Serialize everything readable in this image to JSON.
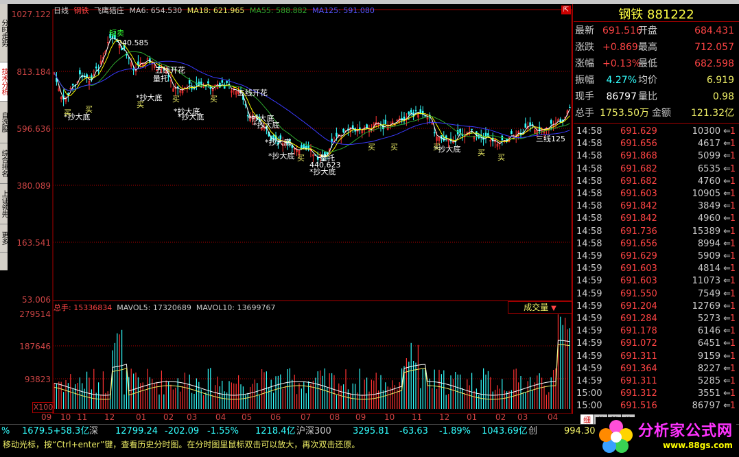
{
  "stock": {
    "name": "钢铁",
    "code": "881222"
  },
  "legend": {
    "period": "日线",
    "name": "钢铁",
    "indicator": "飞鹰猎庄",
    "ma6": "MA6: 654.530",
    "ma18": "MA18: 621.965",
    "ma55": "MA55: 588.882",
    "ma125": "MA125: 591.080"
  },
  "colors": {
    "up": "#ff3333",
    "down": "#33ffff",
    "ma6": "#ffffff",
    "ma18": "#ffff00",
    "ma55": "#2ea82e",
    "ma125": "#3a3aff",
    "axis": "#cc4444"
  },
  "price_axis": [
    "1027.122",
    "813.184",
    "596.636",
    "380.089",
    "163.541",
    "53.006"
  ],
  "vol_axis": [
    "279514",
    "187646",
    "93823"
  ],
  "vol_header": {
    "total": "总手: 15336834",
    "mavol5": "MAVOL5: 17320689",
    "mavol10": "MAVOL10: 13699767"
  },
  "vol_dropdown": "成交量",
  "vol_unit": "X100",
  "dates": [
    "09",
    "10",
    "11",
    "12",
    "01",
    "02",
    "03",
    "04",
    "05",
    "06",
    "07",
    "08",
    "09",
    "10",
    "11",
    "12",
    "01",
    "02",
    "03",
    "04"
  ],
  "annotations": {
    "short_sell": "短卖",
    "high": "940.585",
    "low": "440.623",
    "ma_bloom_1": "五线开花",
    "ma_bloom_2": "五线开花",
    "vol_support": "量托",
    "buy": "买",
    "bottom": "*抄大底",
    "tri125": "三线125",
    "vol_price": "量托"
  },
  "left_tabs": [
    "分时走势",
    "技术分析",
    "自选股",
    "综合排名",
    "上证领先",
    "更多"
  ],
  "quote": {
    "latest_label": "最新",
    "latest": "691.516",
    "open_label": "开盘",
    "open": "684.431",
    "chg_label": "涨跌",
    "chg": "+0.869",
    "high_label": "最高",
    "high": "712.057",
    "pct_label": "涨幅",
    "pct": "+0.13%",
    "low_label": "最低",
    "low": "682.598",
    "amp_label": "振幅",
    "amp": "4.27%",
    "avg_label": "均价",
    "avg": "6.919",
    "cur_label": "现手",
    "cur": "86797",
    "vr_label": "量比",
    "vr": "0.98",
    "tot_label": "总手",
    "tot": "1753.50万",
    "amt_label": "金额",
    "amt": "121.32亿"
  },
  "ticks": [
    {
      "t": "14:58",
      "p": "691.629",
      "q": "10300"
    },
    {
      "t": "14:58",
      "p": "691.656",
      "q": "4617"
    },
    {
      "t": "14:58",
      "p": "691.868",
      "q": "5099"
    },
    {
      "t": "14:58",
      "p": "691.682",
      "q": "6535"
    },
    {
      "t": "14:58",
      "p": "691.682",
      "q": "4760"
    },
    {
      "t": "14:58",
      "p": "691.603",
      "q": "10905"
    },
    {
      "t": "14:58",
      "p": "691.842",
      "q": "3849"
    },
    {
      "t": "14:58",
      "p": "691.842",
      "q": "4960"
    },
    {
      "t": "14:58",
      "p": "691.736",
      "q": "15389"
    },
    {
      "t": "14:58",
      "p": "691.656",
      "q": "8994"
    },
    {
      "t": "14:59",
      "p": "691.629",
      "q": "5909"
    },
    {
      "t": "14:59",
      "p": "691.603",
      "q": "4814"
    },
    {
      "t": "14:59",
      "p": "691.603",
      "q": "11073"
    },
    {
      "t": "14:59",
      "p": "691.550",
      "q": "7549"
    },
    {
      "t": "14:59",
      "p": "691.204",
      "q": "12769"
    },
    {
      "t": "14:59",
      "p": "691.284",
      "q": "5273"
    },
    {
      "t": "14:59",
      "p": "691.178",
      "q": "6146"
    },
    {
      "t": "14:59",
      "p": "691.072",
      "q": "6451"
    },
    {
      "t": "14:59",
      "p": "691.311",
      "q": "9159"
    },
    {
      "t": "14:59",
      "p": "691.364",
      "q": "8227"
    },
    {
      "t": "14:59",
      "p": "691.311",
      "q": "5285"
    },
    {
      "t": "15:00",
      "p": "691.312",
      "q": "3551"
    },
    {
      "t": "15:00",
      "p": "691.516",
      "q": "86797"
    }
  ],
  "tick_arrow": "⇐",
  "tick_flag": "1",
  "tick_tabs": [
    "细",
    "分",
    "笔",
    "价"
  ],
  "index_bar": {
    "pct0": "%",
    "sh_val": "1679.5+58.3亿",
    "sz_label": "深",
    "sz_index": "12799.24",
    "sz_chg": "-202.09",
    "sz_pct": "-1.55%",
    "sz_amt": "1218.4亿",
    "hs300_label": "沪深300",
    "hs300_index": "3295.81",
    "hs300_chg": "-63.63",
    "hs300_pct": "-1.89%",
    "hs300_amt": "1043.69亿",
    "cy_label": "创",
    "cy_index": "994.30"
  },
  "status": "移动光标，按“Ctrl+enter”键，查看历史分时图。在分时图里鼠标双击可以放大，再次双击还原。",
  "logo": {
    "name": "分析家公式网",
    "url": "www.88gs.com"
  }
}
